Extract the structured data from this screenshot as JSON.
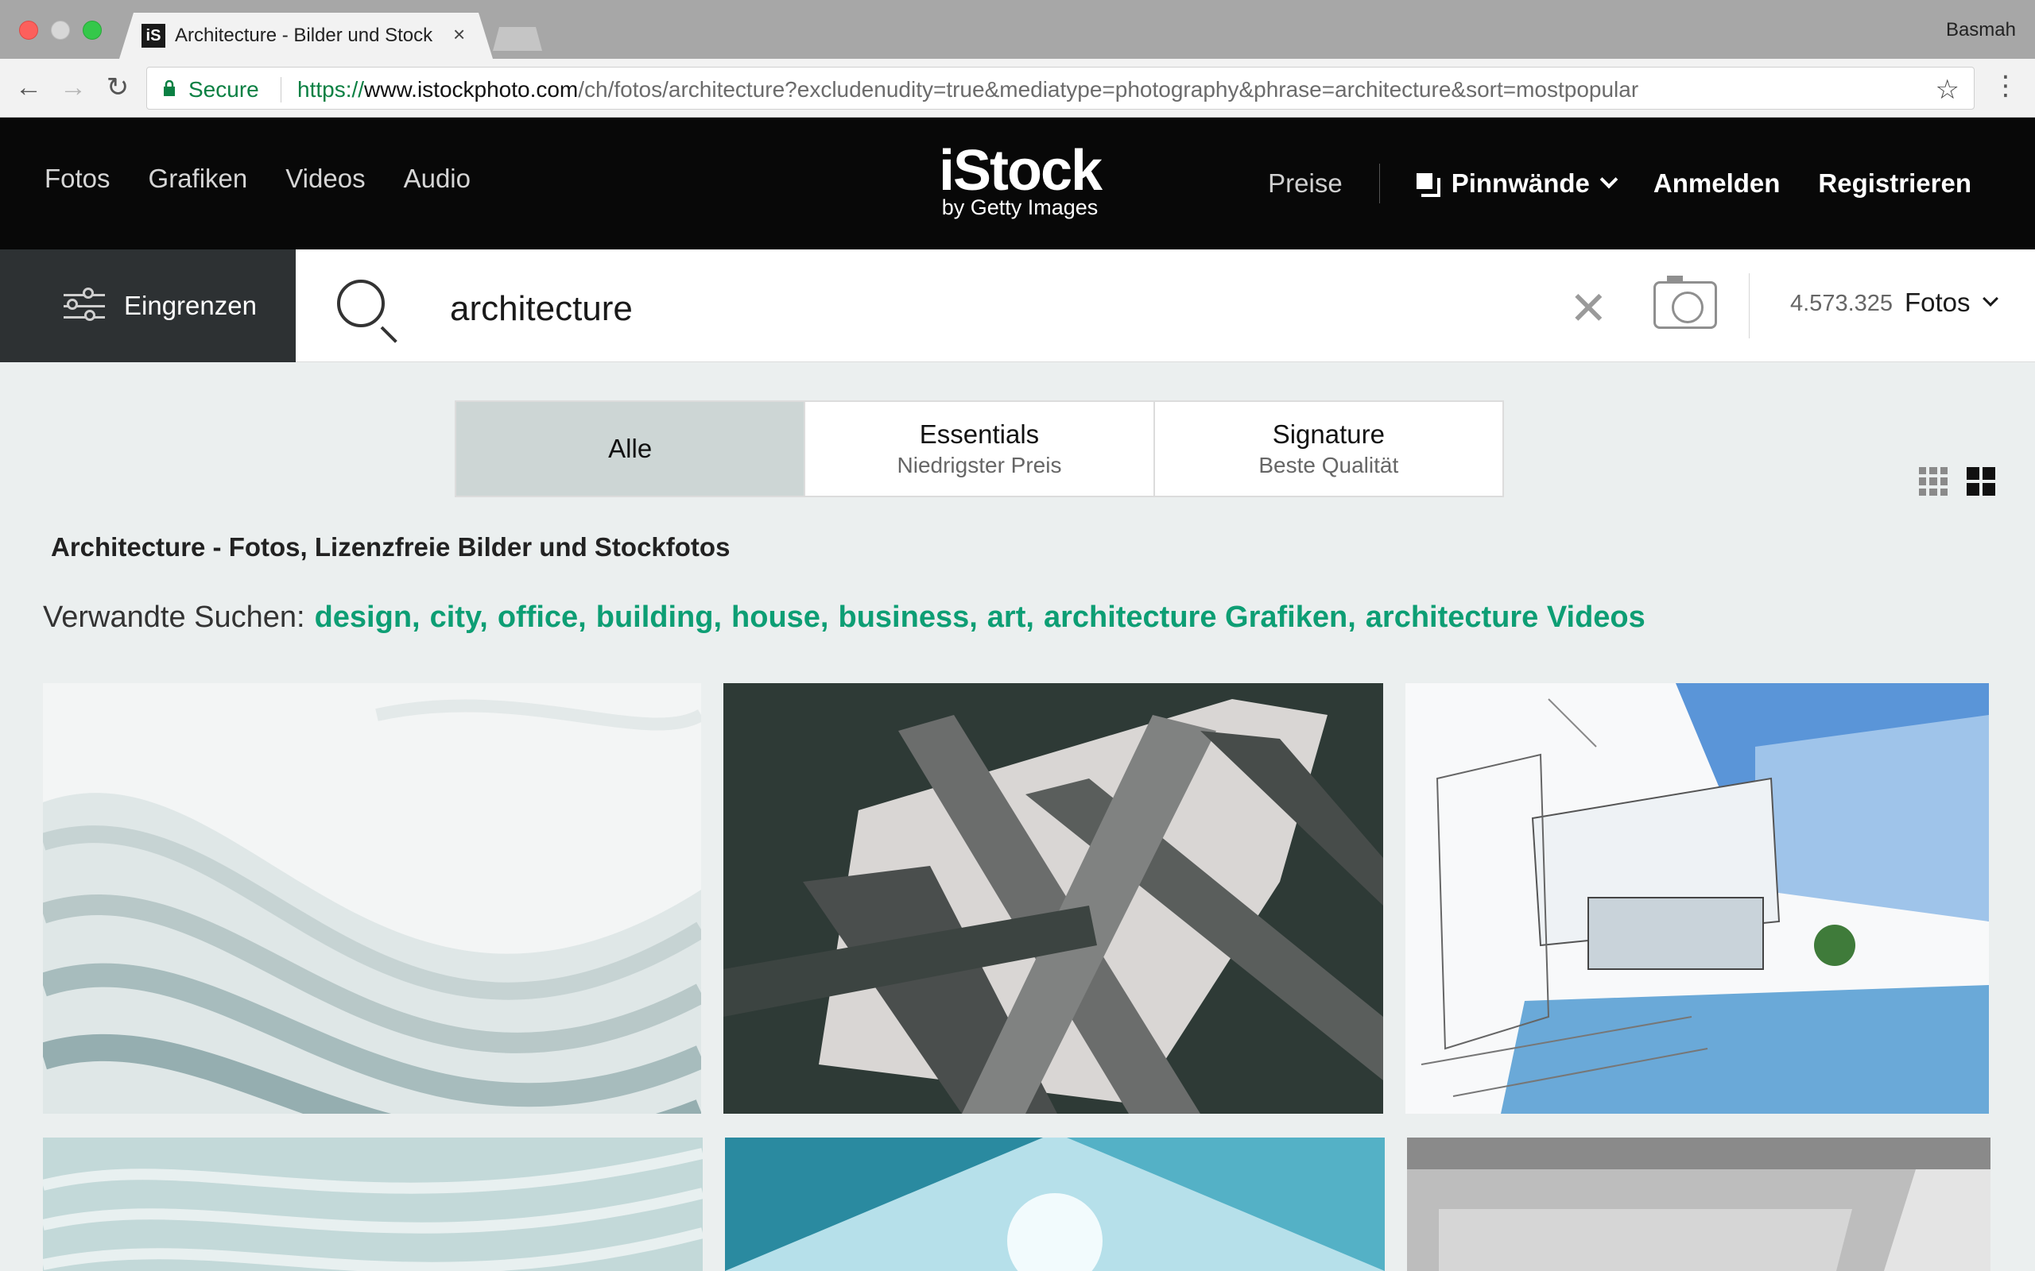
{
  "browser": {
    "tab_title": "Architecture - Bilder und Stock",
    "tab_close": "×",
    "profile": "Basmah",
    "secure_label": "Secure",
    "url_scheme": "https://",
    "url_host": "www.istockphoto.com",
    "url_path": "/ch/fotos/architecture?excludenudity=true&mediatype=photography&phrase=architecture&sort=mostpopular",
    "icons": [
      "back-icon",
      "forward-icon",
      "reload-icon",
      "lock-icon",
      "star-icon",
      "menu-dots-icon"
    ]
  },
  "header": {
    "nav_left": [
      "Fotos",
      "Grafiken",
      "Videos",
      "Audio"
    ],
    "logo_main": "iStock",
    "logo_sub": "by Getty Images",
    "pricing": "Preise",
    "boards": "Pinnwände",
    "login": "Anmelden",
    "register": "Registrieren"
  },
  "search": {
    "refine_label": "Eingrenzen",
    "query": "architecture",
    "result_count": "4.573.325",
    "media_type": "Fotos"
  },
  "segments": [
    {
      "title": "Alle",
      "subtitle": "",
      "active": true
    },
    {
      "title": "Essentials",
      "subtitle": "Niedrigster Preis",
      "active": false
    },
    {
      "title": "Signature",
      "subtitle": "Beste Qualität",
      "active": false
    }
  ],
  "page_title": "Architecture - Fotos, Lizenzfreie Bilder und Stockfotos",
  "related": {
    "label": "Verwandte Suchen:",
    "links": [
      "design,",
      "city,",
      "office,",
      "building,",
      "house,",
      "business,",
      "art,",
      "architecture Grafiken,",
      "architecture Videos"
    ]
  },
  "colors": {
    "header_bg": "#080808",
    "accent_link": "#0d9e74",
    "active_segment": "#cdd6d5",
    "refine_bg": "#2d3133",
    "secure_green": "#0b8043"
  }
}
